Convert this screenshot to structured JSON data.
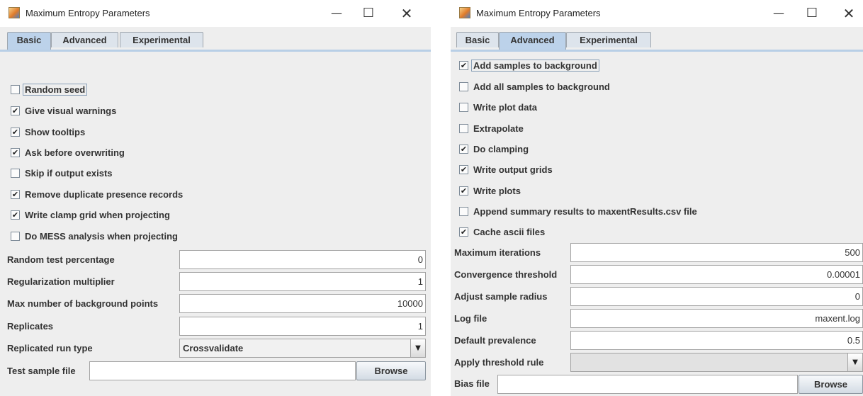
{
  "left": {
    "title": "Maximum Entropy Parameters",
    "controls": {
      "minimize": "—",
      "maximize": "☐",
      "close": "✕"
    },
    "tabs": [
      "Basic",
      "Advanced",
      "Experimental"
    ],
    "active_tab": "Basic",
    "checkboxes": [
      {
        "label": "Random seed",
        "checked": false
      },
      {
        "label": "Give visual warnings",
        "checked": true
      },
      {
        "label": "Show tooltips",
        "checked": true
      },
      {
        "label": "Ask before overwriting",
        "checked": true
      },
      {
        "label": "Skip if output exists",
        "checked": false
      },
      {
        "label": "Remove duplicate presence records",
        "checked": true
      },
      {
        "label": "Write clamp grid when projecting",
        "checked": true
      },
      {
        "label": "Do MESS analysis when projecting",
        "checked": false
      }
    ],
    "fields": [
      {
        "label": "Random test percentage",
        "value": "0"
      },
      {
        "label": "Regularization multiplier",
        "value": "1"
      },
      {
        "label": "Max number of background points",
        "value": "10000"
      },
      {
        "label": "Replicates",
        "value": "1"
      }
    ],
    "run_type": {
      "label": "Replicated run type",
      "value": "Crossvalidate"
    },
    "test_file": {
      "label": "Test sample file",
      "value": "",
      "button": "Browse"
    }
  },
  "right": {
    "title": "Maximum Entropy Parameters",
    "controls": {
      "minimize": "—",
      "maximize": "☐",
      "close": "✕"
    },
    "tabs": [
      "Basic",
      "Advanced",
      "Experimental"
    ],
    "active_tab": "Advanced",
    "checkboxes": [
      {
        "label": "Add samples to background",
        "checked": true
      },
      {
        "label": "Add all samples to background",
        "checked": false
      },
      {
        "label": "Write plot data",
        "checked": false
      },
      {
        "label": "Extrapolate",
        "checked": false
      },
      {
        "label": "Do clamping",
        "checked": true
      },
      {
        "label": "Write output grids",
        "checked": true
      },
      {
        "label": "Write plots",
        "checked": true
      },
      {
        "label": "Append summary results to maxentResults.csv file",
        "checked": false
      },
      {
        "label": "Cache ascii files",
        "checked": true
      }
    ],
    "fields": [
      {
        "label": "Maximum iterations",
        "value": "500"
      },
      {
        "label": "Convergence threshold",
        "value": "0.00001"
      },
      {
        "label": "Adjust sample radius",
        "value": "0"
      },
      {
        "label": "Log file",
        "value": "maxent.log"
      },
      {
        "label": "Default prevalence",
        "value": "0.5"
      }
    ],
    "threshold_rule": {
      "label": "Apply threshold rule",
      "value": ""
    },
    "bias_file": {
      "label": "Bias file",
      "value": "",
      "button": "Browse"
    },
    "check_mark": "✔",
    "combo_arrow": "▼"
  }
}
